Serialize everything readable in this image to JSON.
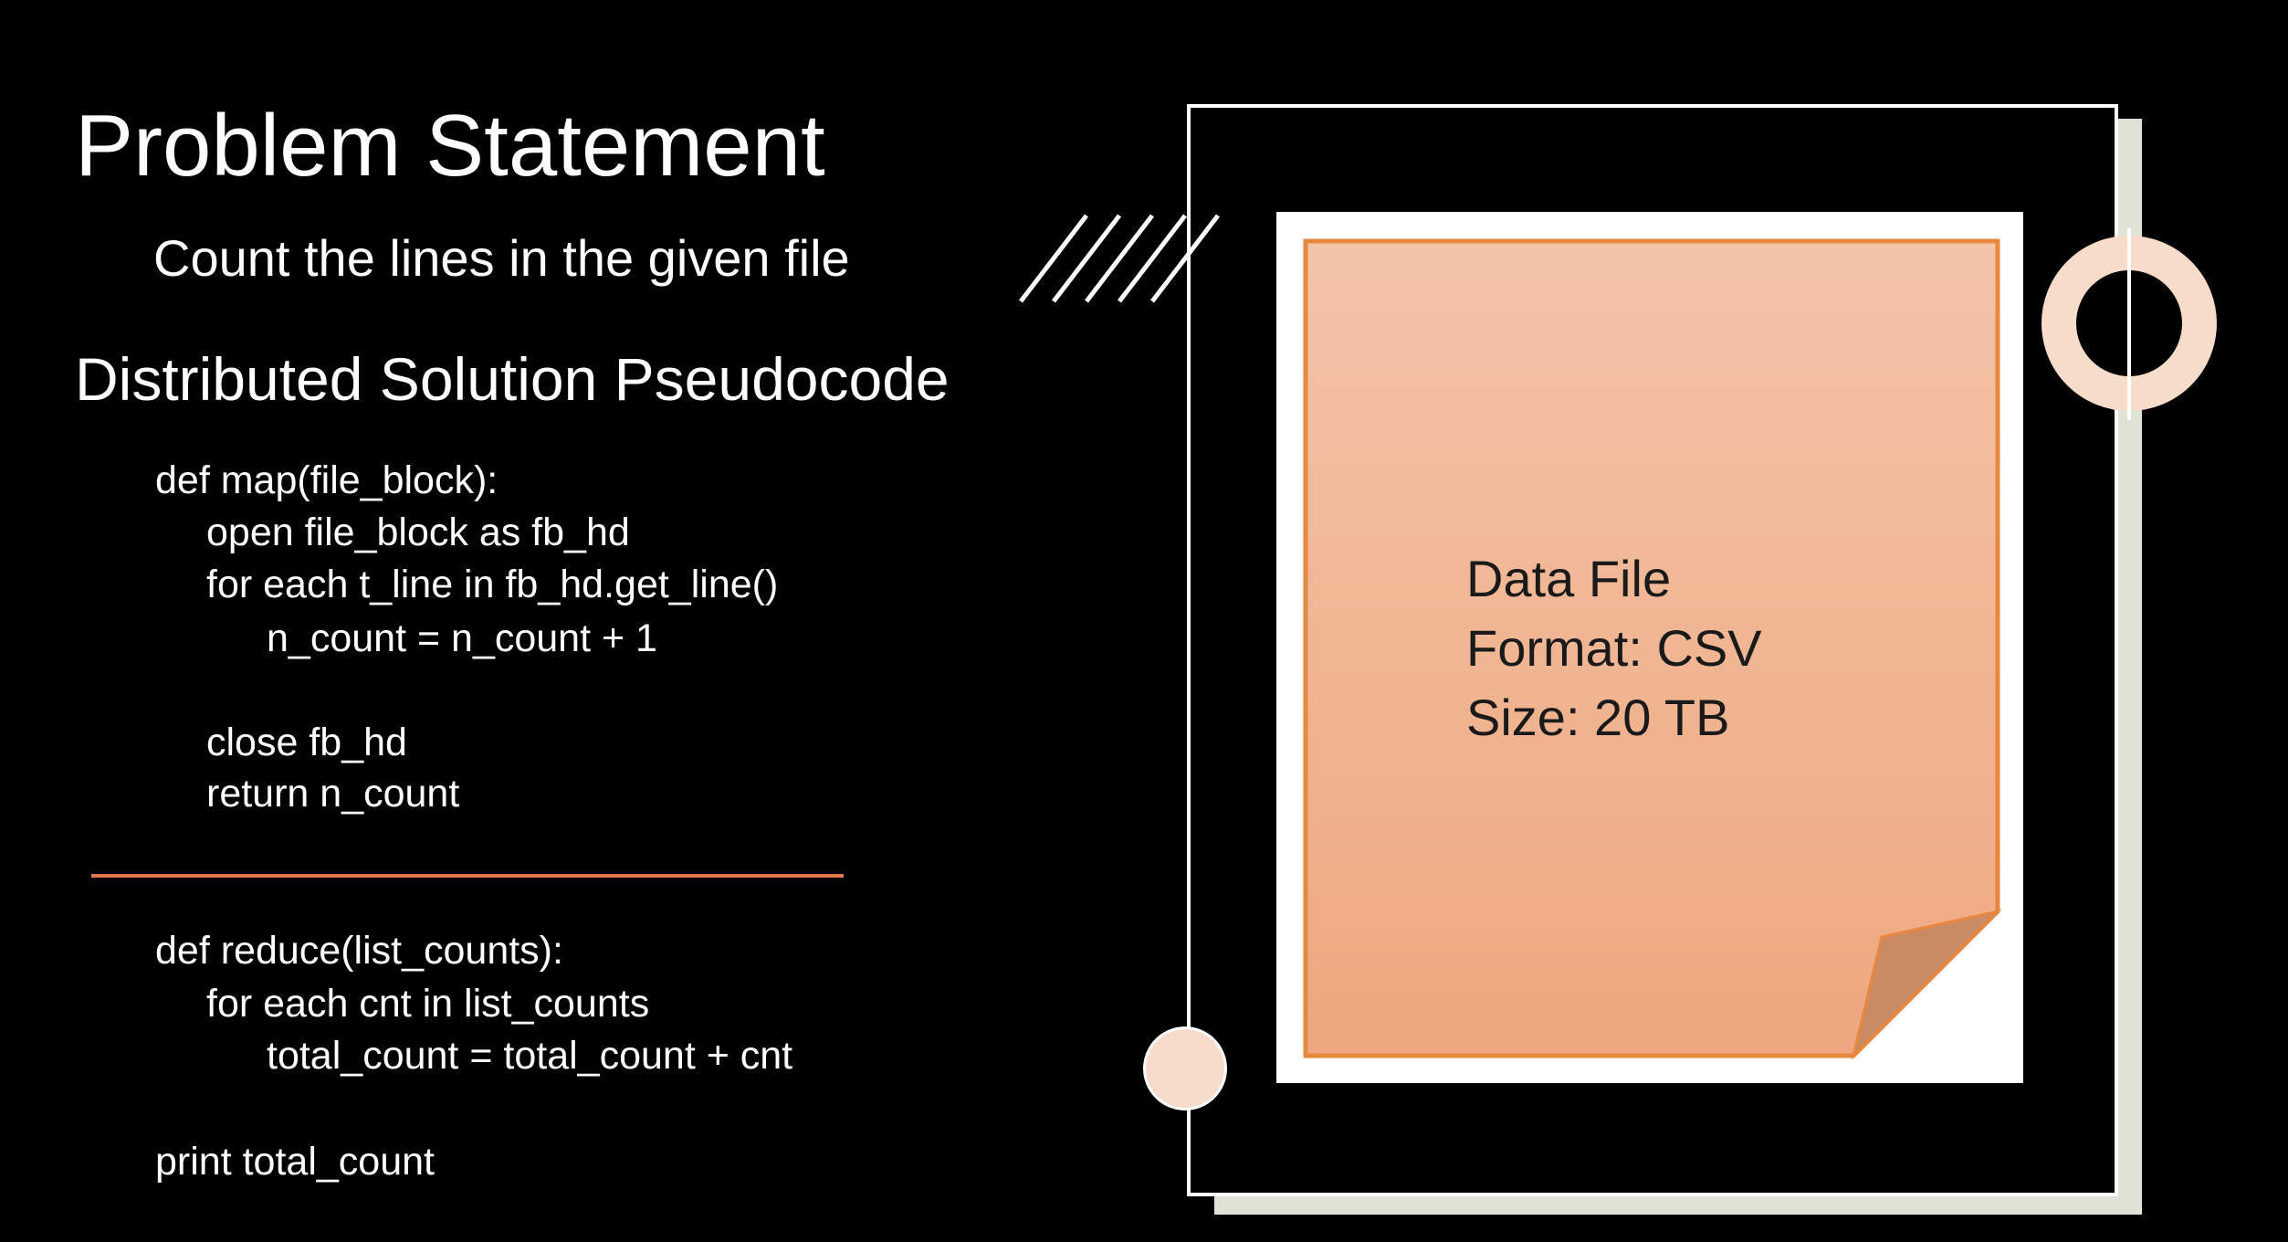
{
  "slide": {
    "title": "Problem Statement",
    "subtitle": "Count the lines in the given file",
    "section_heading": "Distributed Solution Pseudocode"
  },
  "map_code": [
    "def map(file_block):",
    "open file_block as fb_hd",
    "for each t_line in fb_hd.get_line()",
    "n_count = n_count + 1",
    "close fb_hd",
    "return n_count"
  ],
  "reduce_code": [
    "def reduce(list_counts):",
    "for each cnt in list_counts",
    "total_count = total_count + cnt",
    "print total_count"
  ],
  "data_file": {
    "line1": "Data File",
    "line2": "Format: CSV",
    "line3": "Size: 20 TB"
  },
  "colors": {
    "background": "#000000",
    "accent": "#e07a4a",
    "paper_fill": "#f0b18c",
    "paper_border": "#e8883e",
    "ring": "#f7dccb",
    "frame_shadow": "#dfe3d6"
  }
}
